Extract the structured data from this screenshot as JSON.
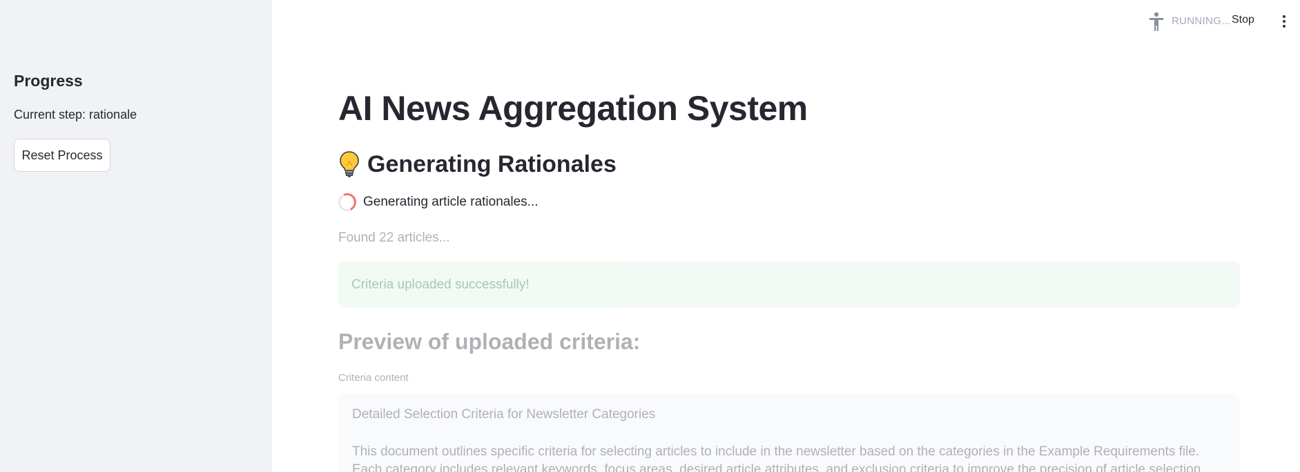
{
  "sidebar": {
    "title": "Progress",
    "current_step": "Current step: rationale",
    "reset_label": "Reset Process"
  },
  "toolbar": {
    "status": "RUNNING...",
    "stop_label": "Stop"
  },
  "main": {
    "title": "AI News Aggregation System",
    "section_title": "Generating Rationales",
    "spinner_text": "Generating article rationales...",
    "found_text": "Found 22 articles...",
    "success_text": "Criteria uploaded successfully!",
    "preview_title": "Preview of uploaded criteria:",
    "criteria_label": "Criteria content",
    "criteria_line1": "Detailed Selection Criteria for Newsletter Categories",
    "criteria_line2": "This document outlines specific criteria for selecting articles to include in the newsletter based on the categories in the Example Requirements file. Each category includes relevant keywords, focus areas, desired article attributes, and exclusion criteria to improve the precision of article selection."
  },
  "colors": {
    "sidebar_bg": "#f0f2f6",
    "spinner_accent": "#ff6b6b",
    "success_bg": "#dff3e4",
    "success_text": "#177233"
  },
  "icons": {
    "section": "lightbulb-icon",
    "status": "accessibility-person-icon",
    "menu": "kebab-menu-icon"
  }
}
